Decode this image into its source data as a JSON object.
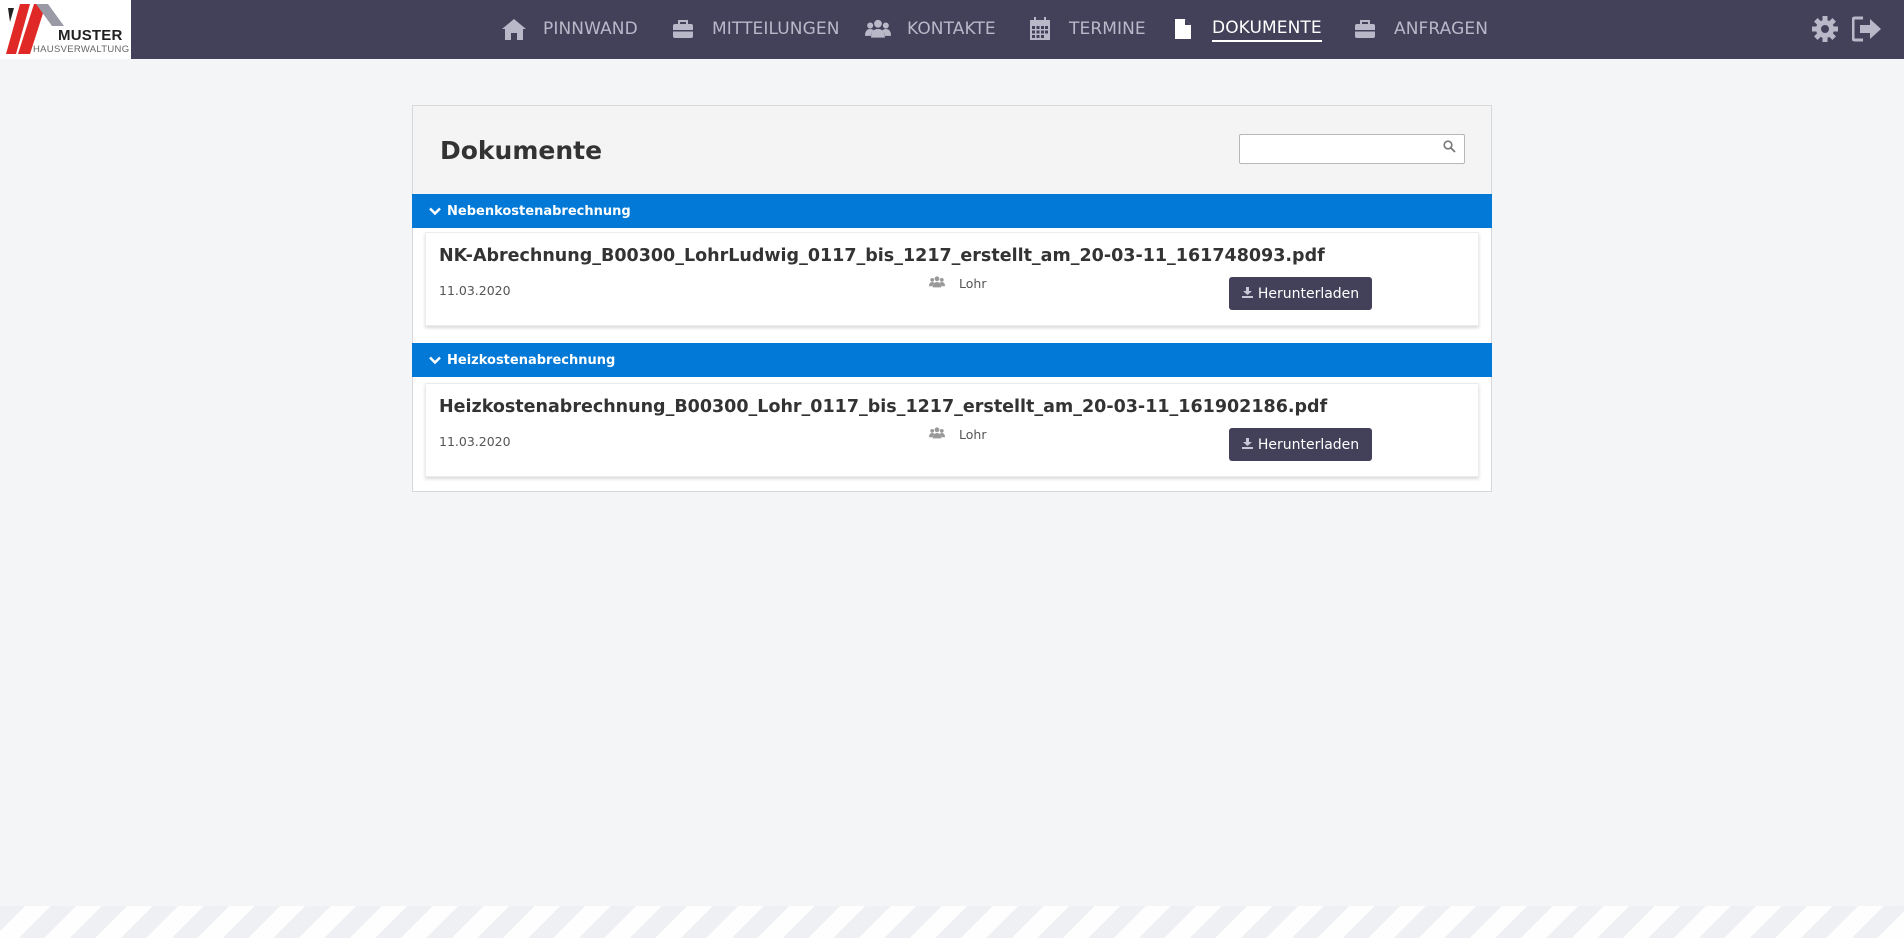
{
  "logo": {
    "brand": "MUSTER",
    "sub": "HAUSVERWALTUNG"
  },
  "nav": {
    "items": [
      {
        "label": "PINNWAND",
        "icon": "home-icon"
      },
      {
        "label": "MITTEILUNGEN",
        "icon": "briefcase-icon"
      },
      {
        "label": "KONTAKTE",
        "icon": "users-icon"
      },
      {
        "label": "TERMINE",
        "icon": "calendar-icon"
      },
      {
        "label": "DOKUMENTE",
        "icon": "file-icon",
        "active": true
      },
      {
        "label": "ANFRAGEN",
        "icon": "briefcase-icon"
      }
    ],
    "right_icons": [
      "gear-icon",
      "logout-icon"
    ]
  },
  "page": {
    "title": "Dokumente",
    "search": {
      "value": "",
      "placeholder": ""
    }
  },
  "categories": [
    {
      "label": "Nebenkostenabrechnung",
      "documents": [
        {
          "title": "NK-Abrechnung_B00300_LohrLudwig_0117_bis_1217_erstellt_am_20-03-11_161748093.pdf",
          "date": "11.03.2020",
          "owner": "Lohr",
          "button": "Herunterladen"
        }
      ]
    },
    {
      "label": "Heizkostenabrechnung",
      "documents": [
        {
          "title": "Heizkostenabrechnung_B00300_Lohr_0117_bis_1217_erstellt_am_20-03-11_161902186.pdf",
          "date": "11.03.2020",
          "owner": "Lohr",
          "button": "Herunterladen"
        }
      ]
    }
  ],
  "colors": {
    "topbar": "#434159",
    "category": "#0279d7",
    "background": "#f4f5f7",
    "button": "#434159"
  }
}
